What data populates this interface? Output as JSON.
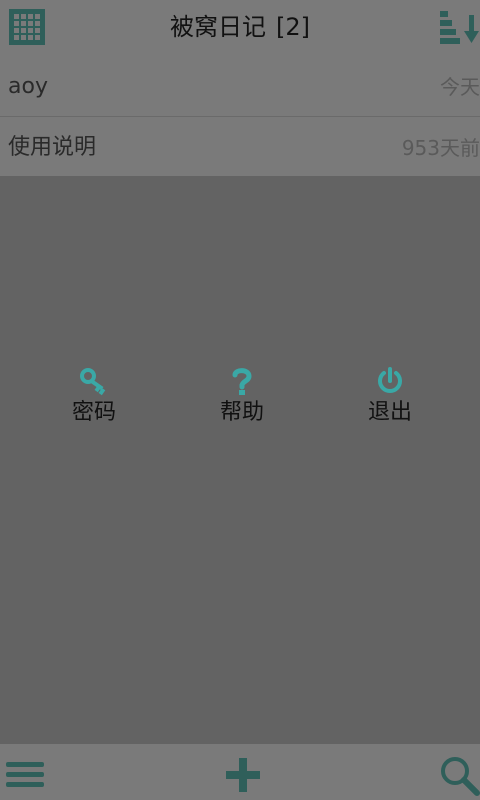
{
  "header": {
    "title": "被窝日记",
    "count": "[2]",
    "left_icon": "grid-view-icon",
    "right_icon": "sort-icon"
  },
  "entries": [
    {
      "name": "aoy",
      "date": "今天"
    },
    {
      "name": "使用说明",
      "date": "953天前"
    }
  ],
  "menu": {
    "items": [
      {
        "label": "密码",
        "icon": "key-icon"
      },
      {
        "label": "帮助",
        "icon": "help-icon"
      },
      {
        "label": "退出",
        "icon": "power-icon"
      }
    ]
  },
  "bottombar": {
    "left_icon": "menu-icon",
    "center_icon": "add-icon",
    "right_icon": "search-icon"
  },
  "colors": {
    "accent": "#2f5f5a",
    "menu_icon": "#3aa8a6",
    "overlay": "#636363"
  }
}
